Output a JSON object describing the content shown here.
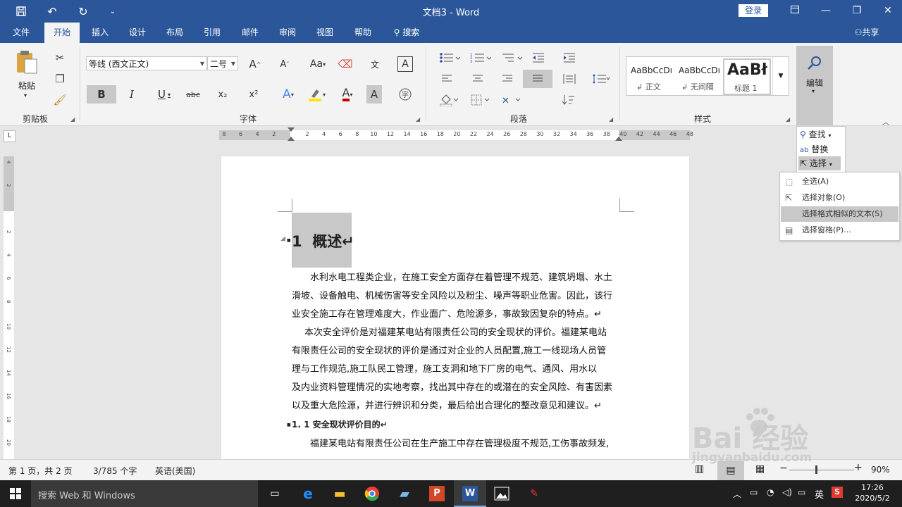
{
  "titlebar": {
    "doc_title": "文档3 - Word",
    "login": "登录"
  },
  "tabs": [
    "文件",
    "开始",
    "插入",
    "设计",
    "布局",
    "引用",
    "邮件",
    "审阅",
    "视图",
    "帮助",
    "搜索"
  ],
  "share": "共享",
  "ribbon": {
    "clipboard": {
      "paste": "粘贴",
      "label": "剪贴板"
    },
    "font": {
      "name": "等线 (西文正文)",
      "size": "二号",
      "label": "字体",
      "btn_aa": "Aa",
      "bold": "B",
      "italic": "I",
      "underline": "U",
      "strike": "abc",
      "sub": "x₂",
      "sup": "x²",
      "font_color": "A"
    },
    "paragraph": {
      "label": "段落"
    },
    "styles": {
      "label": "样式",
      "items": [
        {
          "preview": "AaBbCcDı",
          "name": "↲ 正文"
        },
        {
          "preview": "AaBbCcDı",
          "name": "↲ 无间隔"
        },
        {
          "preview": "AaBł",
          "name": "标题 1"
        }
      ]
    },
    "edit": {
      "label": "编辑"
    }
  },
  "edit_menu": {
    "find": "查找",
    "replace": "替换",
    "select": "选择"
  },
  "select_menu": [
    {
      "label": "全选(A)",
      "icon": "select-all-icon"
    },
    {
      "label": "选择对象(O)",
      "icon": "cursor-icon"
    },
    {
      "label": "选择格式相似的文本(S)",
      "icon": "none"
    },
    {
      "label": "选择窗格(P)...",
      "icon": "selection-pane-icon"
    }
  ],
  "ruler": {
    "h_ticks": [
      "8",
      "6",
      "4",
      "2",
      "",
      "2",
      "4",
      "6",
      "8",
      "10",
      "12",
      "14",
      "16",
      "18",
      "20",
      "22",
      "24",
      "26",
      "28",
      "30",
      "32",
      "34",
      "36",
      "38",
      "40",
      "42",
      "44",
      "46",
      "48"
    ],
    "v_ticks": [
      "4",
      "2",
      "",
      "2",
      "4",
      "6",
      "8",
      "10",
      "12",
      "14",
      "16",
      "18",
      "20"
    ]
  },
  "document": {
    "heading": "1  概述↵",
    "paragraphs": [
      [
        "水利水电工程类企业，在施工安全方面存在着管理不规范、建筑坍塌、水土",
        "滑坡、设备触电、机械伤害等安全风险以及粉尘、噪声等职业危害。因此，该行",
        "业安全施工存在管理难度大，作业面广、危险源多，事故致因复杂的特点。↵"
      ],
      [
        "本次安全评价是对福建某电站有限责任公司的安全现状的评价。福建某电站",
        "有限责任公司的安全现状的评价是通过对企业的人员配置,施工一线现场人员管",
        "理与工作规范,施工队民工管理，施工支洞和地下厂房的电气、通风、用水以",
        "及内业资料管理情况的实地考察，找出其中存在的或潜在的安全风险、有害因素",
        "以及重大危险源，并进行辨识和分类，最后给出合理化的整改意见和建议。↵"
      ]
    ],
    "subheading": "1. 1 安全现状评价目的↵",
    "para3_line1": "福建某电站有限责任公司在生产施工中存在管理极度不规范,工伤事故频发,"
  },
  "statusbar": {
    "page": "第 1 页，共 2 页",
    "words": "3/785 个字",
    "lang": "英语(美国)",
    "zoom": "90%"
  },
  "taskbar": {
    "search": "搜索 Web 和 Windows",
    "ime": "英",
    "time": "17:26",
    "date": "2020/5/2"
  },
  "watermark": {
    "text": "Bai 经验",
    "url": "jingyanbaidu.com"
  },
  "colors": {
    "word_blue": "#2b579a",
    "ribbon_bg": "#f3f3f3",
    "highlight": "#c8c8c8"
  }
}
